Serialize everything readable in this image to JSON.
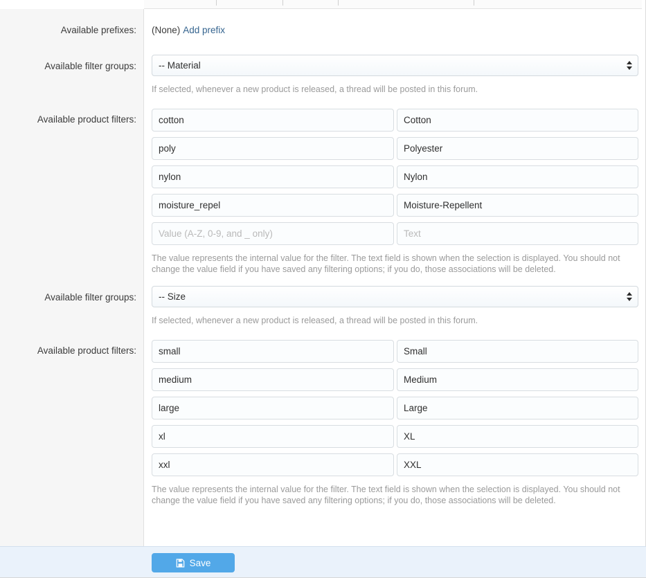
{
  "colors": {
    "accent": "#52a8e8",
    "link": "#35648f",
    "gutter_bg": "#f6f6f6",
    "footer_bg": "#eaf2fb",
    "hint_text": "#9a9a9a"
  },
  "rows": {
    "prefixes": {
      "label": "Available prefixes:",
      "value": "(None)",
      "add_link": "Add prefix"
    },
    "material_group": {
      "label": "Available filter groups:",
      "selected": "-- Material",
      "hint": "If selected, whenever a new product is released, a thread will be posted in this forum."
    },
    "material_filters": {
      "label": "Available product filters:",
      "hint": "The value represents the internal value for the filter. The text field is shown when the selection is displayed. You should not change the value field if you have saved any filtering options; if you do, those associations will be deleted.",
      "value_placeholder": "Value (A-Z, 0-9, and _ only)",
      "text_placeholder": "Text",
      "items": [
        {
          "value": "cotton",
          "text": "Cotton"
        },
        {
          "value": "poly",
          "text": "Polyester"
        },
        {
          "value": "nylon",
          "text": "Nylon"
        },
        {
          "value": "moisture_repel",
          "text": "Moisture-Repellent"
        },
        {
          "value": "",
          "text": ""
        }
      ]
    },
    "size_group": {
      "label": "Available filter groups:",
      "selected": "-- Size",
      "hint": "If selected, whenever a new product is released, a thread will be posted in this forum."
    },
    "size_filters": {
      "label": "Available product filters:",
      "hint": "The value represents the internal value for the filter. The text field is shown when the selection is displayed. You should not change the value field if you have saved any filtering options; if you do, those associations will be deleted.",
      "value_placeholder": "Value (A-Z, 0-9, and _ only)",
      "text_placeholder": "Text",
      "items": [
        {
          "value": "small",
          "text": "Small"
        },
        {
          "value": "medium",
          "text": "Medium"
        },
        {
          "value": "large",
          "text": "Large"
        },
        {
          "value": "xl",
          "text": "XL"
        },
        {
          "value": "xxl",
          "text": "XXL"
        }
      ]
    }
  },
  "footer": {
    "save_label": "Save",
    "save_icon": "floppy-disk-save-icon"
  }
}
